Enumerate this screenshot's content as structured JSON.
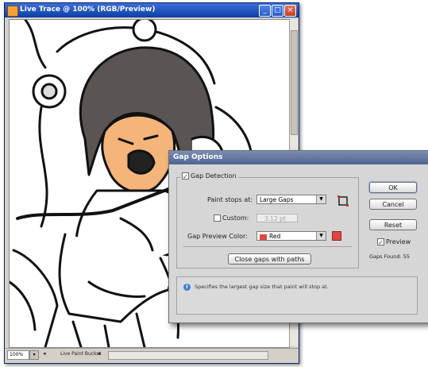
{
  "document_window": {
    "title": "Live Trace @ 100% (RGB/Preview)",
    "controls": {
      "minimize": "_",
      "maximize": "□",
      "close": "×"
    },
    "statusbar": {
      "zoom": "100%",
      "tool": "Live Paint Bucket",
      "nav_first": "◂",
      "nav_last": "▸"
    }
  },
  "dialog": {
    "title": "Gap Options",
    "gap_detection": {
      "label": "Gap Detection",
      "checked": true,
      "check_mark": "✓"
    },
    "paint_stops": {
      "label": "Paint stops at:",
      "value": "Large Gaps"
    },
    "custom": {
      "label": "Custom:",
      "checked": false,
      "value": "3.12 pt"
    },
    "preview_color": {
      "label": "Gap Preview Color:",
      "value": "Red",
      "swatch_color": "#e0463f"
    },
    "close_gaps_button": "Close gaps with paths",
    "buttons": {
      "ok": "OK",
      "cancel": "Cancel",
      "reset": "Reset"
    },
    "preview": {
      "label": "Preview",
      "checked": true,
      "check_mark": "✓"
    },
    "gaps_found": "Gaps Found: 55",
    "info": {
      "icon": "i",
      "text": "Specifies the largest gap size that paint will stop at."
    }
  }
}
